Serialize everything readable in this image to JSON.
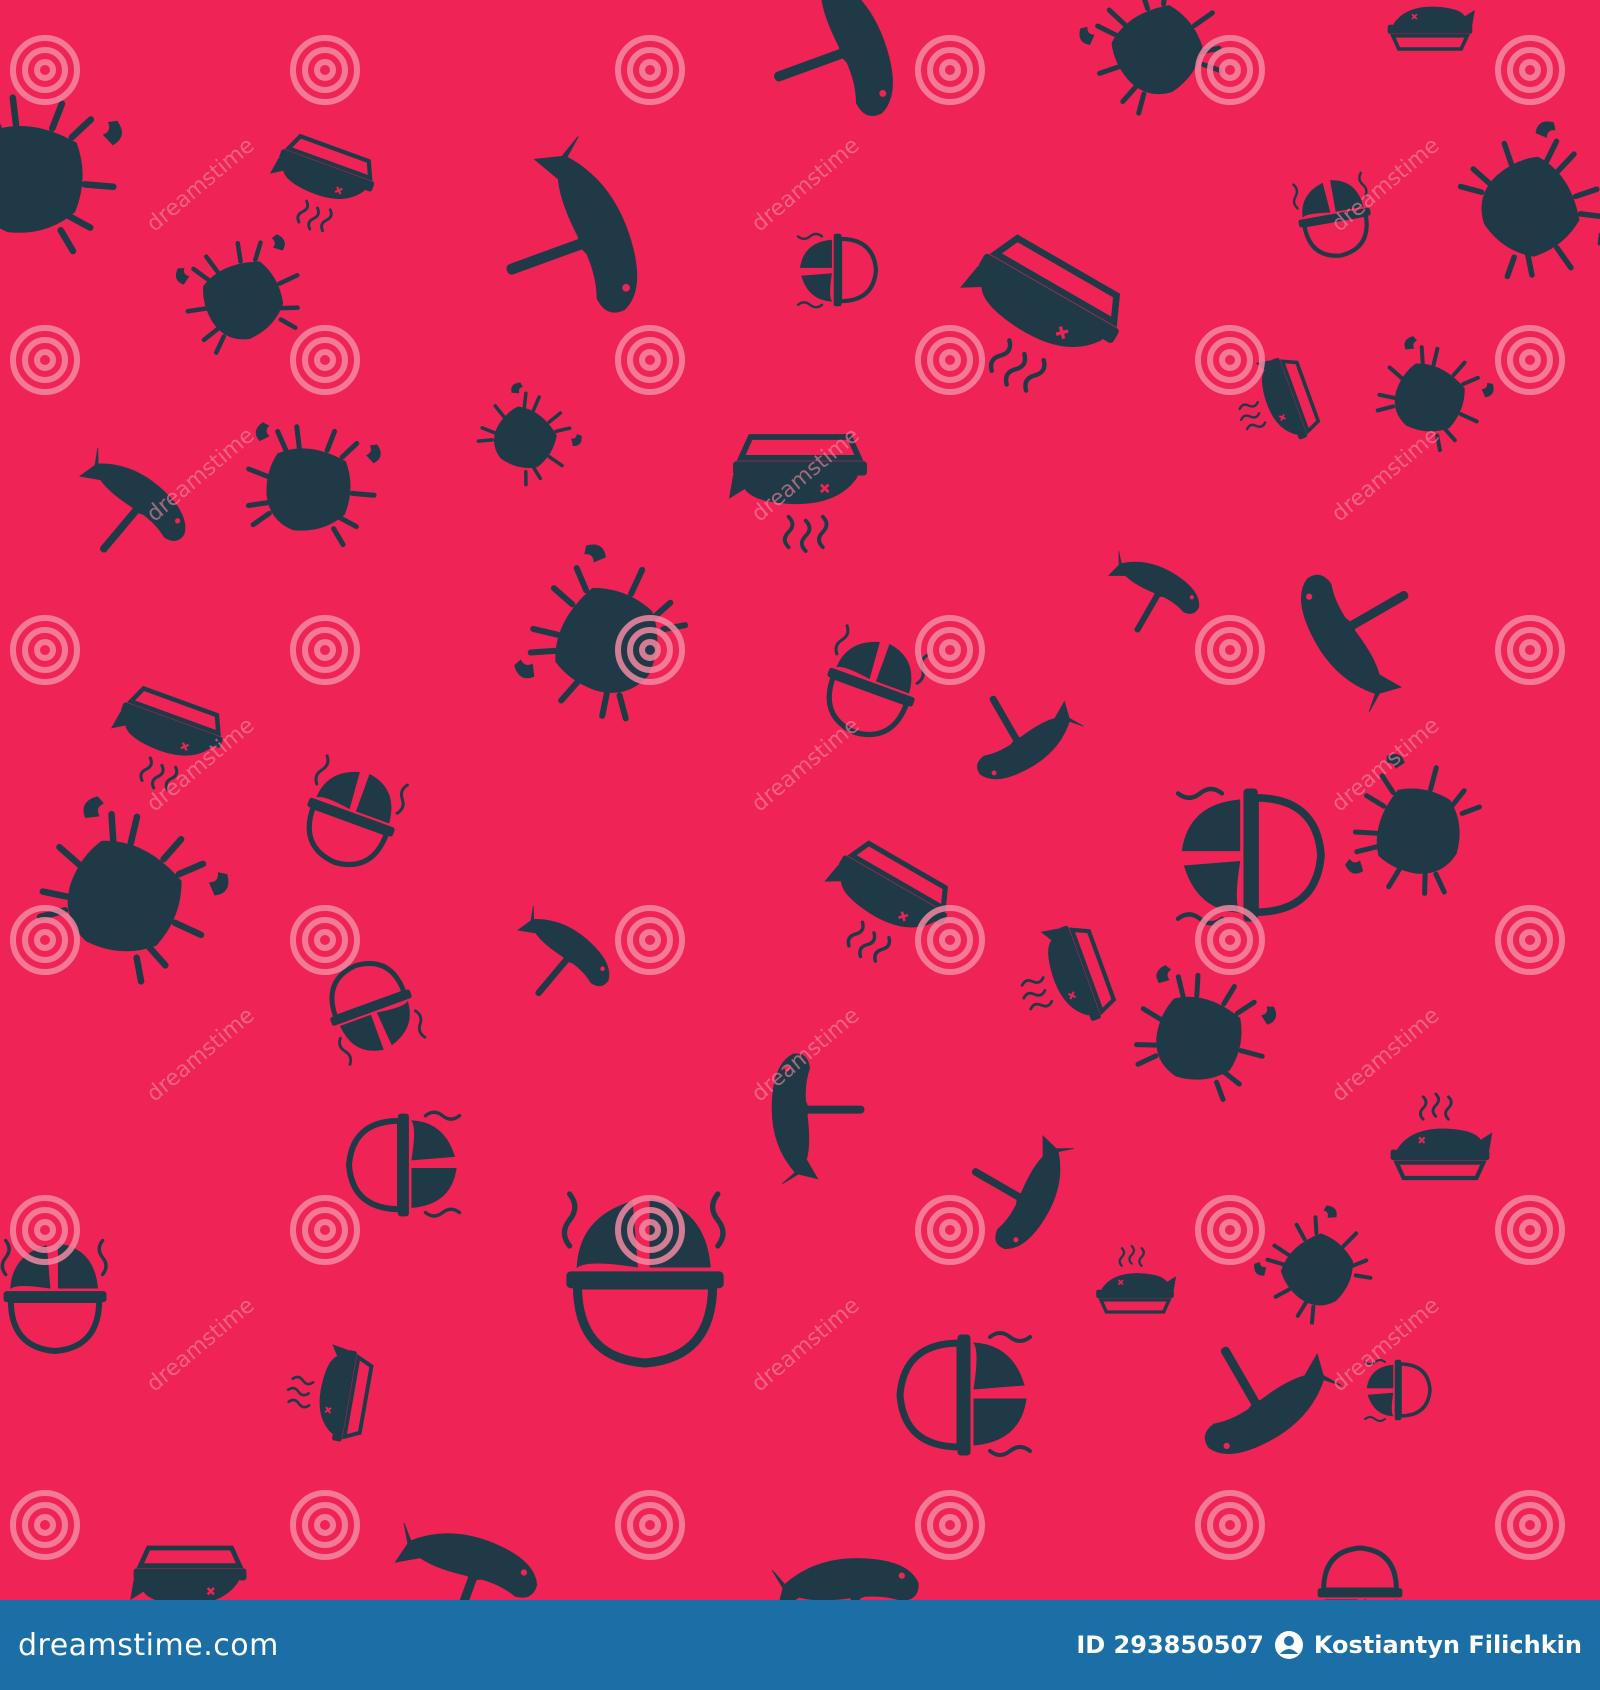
{
  "image": {
    "background_color": "#ef2356",
    "icon_color": "#1f3a46",
    "watermark_color": "#f48aa3",
    "icons": [
      "crab-icon",
      "fish-on-fork-icon",
      "fish-in-pan-icon",
      "cooking-pot-icon"
    ]
  },
  "watermark": {
    "text": "dreamstime"
  },
  "footer": {
    "background_color": "#1b6fa6",
    "site": "dreamstime.com",
    "id_text": "ID 293850507",
    "author": "Kostiantyn Filichkin"
  }
}
